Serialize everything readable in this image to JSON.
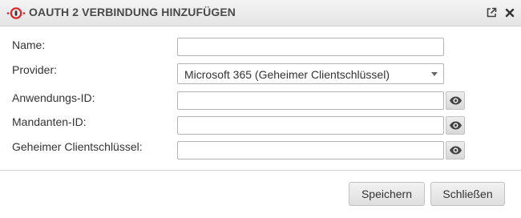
{
  "dialog": {
    "title": "OAUTH 2 VERBINDUNG HINZUFÜGEN",
    "icons": [
      "logo-icon",
      "external-link-icon",
      "close-icon"
    ],
    "accent_color": "#d6262b"
  },
  "form": {
    "name": {
      "label": "Name:",
      "value": ""
    },
    "provider": {
      "label": "Provider:",
      "selected": "Microsoft 365 (Geheimer Clientschlüssel)"
    },
    "application_id": {
      "label": "Anwendungs-ID:",
      "value": ""
    },
    "tenant_id": {
      "label": "Mandanten-ID:",
      "value": ""
    },
    "client_secret": {
      "label": "Geheimer Clientschlüssel:",
      "value": ""
    }
  },
  "buttons": {
    "save": "Speichern",
    "close": "Schließen"
  }
}
